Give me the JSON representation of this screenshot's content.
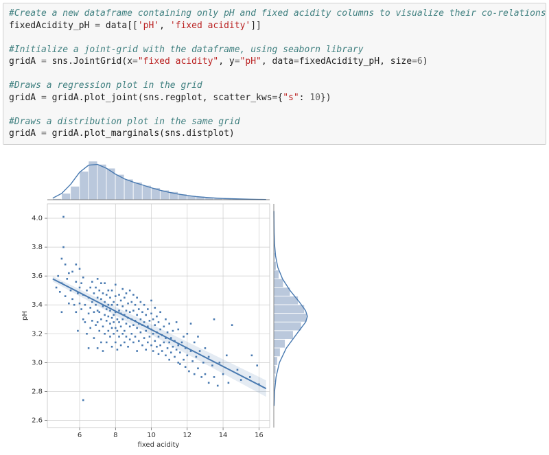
{
  "code": {
    "c1": "#Create a new dataframe containing only pH and fixed acidity columns to visualize their co-relations",
    "l1a": "fixedAcidity_pH ",
    "l1b": "=",
    "l1c": " data[[",
    "l1d": "'pH'",
    "l1e": ", ",
    "l1f": "'fixed acidity'",
    "l1g": "]]",
    "c2": "#Initialize a joint-grid with the dataframe, using seaborn library",
    "l2a": "gridA ",
    "l2b": "=",
    "l2c": " sns.JointGrid(x",
    "l2d": "=",
    "l2e": "\"fixed acidity\"",
    "l2f": ", y",
    "l2g": "=",
    "l2h": "\"pH\"",
    "l2i": ", data",
    "l2j": "=",
    "l2k": "fixedAcidity_pH, size",
    "l2l": "=",
    "l2m": "6",
    "l2n": ")",
    "c3": "#Draws a regression plot in the grid",
    "l3a": "gridA ",
    "l3b": "=",
    "l3c": " gridA.plot_joint(sns.regplot, scatter_kws",
    "l3d": "=",
    "l3e": "{",
    "l3f": "\"s\"",
    "l3g": ": ",
    "l3h": "10",
    "l3i": "})",
    "c4": "#Draws a distribution plot in the same grid",
    "l4a": "gridA ",
    "l4b": "=",
    "l4c": " gridA.plot_marginals(sns.distplot)"
  },
  "chart_data": {
    "type": "jointplot",
    "main": {
      "type": "scatter+regression",
      "xlabel": "fixed acidity",
      "ylabel": "pH",
      "x_ticks": [
        6,
        8,
        10,
        12,
        14,
        16
      ],
      "y_ticks": [
        2.6,
        2.8,
        3.0,
        3.2,
        3.4,
        3.6,
        3.8,
        4.0
      ],
      "xlim": [
        4.2,
        16.6
      ],
      "ylim": [
        2.55,
        4.1
      ],
      "regression": {
        "x0": 4.5,
        "y0": 3.58,
        "x1": 16.4,
        "y1": 2.82
      },
      "scatter_sample": [
        [
          4.7,
          3.52
        ],
        [
          4.8,
          3.6
        ],
        [
          4.9,
          3.49
        ],
        [
          5.0,
          3.72
        ],
        [
          5.0,
          3.55
        ],
        [
          5.0,
          3.35
        ],
        [
          5.1,
          4.01
        ],
        [
          5.1,
          3.8
        ],
        [
          5.2,
          3.46
        ],
        [
          5.2,
          3.68
        ],
        [
          5.3,
          3.58
        ],
        [
          5.4,
          3.62
        ],
        [
          5.4,
          3.41
        ],
        [
          5.5,
          3.5
        ],
        [
          5.6,
          3.44
        ],
        [
          5.6,
          3.63
        ],
        [
          5.7,
          3.4
        ],
        [
          5.8,
          3.56
        ],
        [
          5.8,
          3.35
        ],
        [
          5.8,
          3.68
        ],
        [
          5.9,
          3.48
        ],
        [
          5.9,
          3.22
        ],
        [
          6.0,
          3.52
        ],
        [
          6.0,
          3.41
        ],
        [
          6.0,
          3.65
        ],
        [
          6.1,
          3.37
        ],
        [
          6.1,
          3.55
        ],
        [
          6.2,
          2.74
        ],
        [
          6.2,
          3.3
        ],
        [
          6.2,
          3.47
        ],
        [
          6.2,
          3.59
        ],
        [
          6.3,
          3.4
        ],
        [
          6.3,
          3.28
        ],
        [
          6.4,
          3.5
        ],
        [
          6.4,
          3.2
        ],
        [
          6.5,
          3.45
        ],
        [
          6.5,
          3.34
        ],
        [
          6.5,
          3.1
        ],
        [
          6.6,
          3.38
        ],
        [
          6.6,
          3.52
        ],
        [
          6.6,
          3.24
        ],
        [
          6.7,
          3.29
        ],
        [
          6.7,
          3.42
        ],
        [
          6.7,
          3.56
        ],
        [
          6.8,
          3.35
        ],
        [
          6.8,
          3.17
        ],
        [
          6.8,
          3.48
        ],
        [
          6.9,
          3.26
        ],
        [
          6.9,
          3.4
        ],
        [
          6.9,
          3.52
        ],
        [
          7.0,
          3.28
        ],
        [
          7.0,
          3.1
        ],
        [
          7.0,
          3.36
        ],
        [
          7.0,
          3.45
        ],
        [
          7.0,
          3.58
        ],
        [
          7.1,
          3.22
        ],
        [
          7.1,
          3.35
        ],
        [
          7.1,
          3.5
        ],
        [
          7.2,
          3.3
        ],
        [
          7.2,
          3.14
        ],
        [
          7.2,
          3.44
        ],
        [
          7.2,
          3.55
        ],
        [
          7.3,
          3.39
        ],
        [
          7.3,
          3.25
        ],
        [
          7.3,
          3.08
        ],
        [
          7.3,
          3.48
        ],
        [
          7.4,
          3.33
        ],
        [
          7.4,
          3.2
        ],
        [
          7.4,
          3.42
        ],
        [
          7.4,
          3.55
        ],
        [
          7.5,
          3.29
        ],
        [
          7.5,
          3.37
        ],
        [
          7.5,
          3.14
        ],
        [
          7.5,
          3.47
        ],
        [
          7.6,
          3.32
        ],
        [
          7.6,
          3.22
        ],
        [
          7.6,
          3.4
        ],
        [
          7.6,
          3.5
        ],
        [
          7.7,
          3.27
        ],
        [
          7.7,
          3.36
        ],
        [
          7.7,
          3.18
        ],
        [
          7.7,
          3.45
        ],
        [
          7.8,
          3.31
        ],
        [
          7.8,
          3.24
        ],
        [
          7.8,
          3.4
        ],
        [
          7.8,
          3.11
        ],
        [
          7.8,
          3.5
        ],
        [
          7.9,
          3.33
        ],
        [
          7.9,
          3.2
        ],
        [
          7.9,
          3.42
        ],
        [
          7.9,
          3.28
        ],
        [
          8.0,
          3.35
        ],
        [
          8.0,
          3.24
        ],
        [
          8.0,
          3.14
        ],
        [
          8.0,
          3.46
        ],
        [
          8.0,
          3.54
        ],
        [
          8.1,
          3.3
        ],
        [
          8.1,
          3.22
        ],
        [
          8.1,
          3.4
        ],
        [
          8.1,
          3.09
        ],
        [
          8.2,
          3.28
        ],
        [
          8.2,
          3.36
        ],
        [
          8.2,
          3.18
        ],
        [
          8.2,
          3.47
        ],
        [
          8.3,
          3.25
        ],
        [
          8.3,
          3.34
        ],
        [
          8.3,
          3.12
        ],
        [
          8.3,
          3.43
        ],
        [
          8.4,
          3.3
        ],
        [
          8.4,
          3.2
        ],
        [
          8.4,
          3.39
        ],
        [
          8.4,
          3.51
        ],
        [
          8.5,
          3.22
        ],
        [
          8.5,
          3.33
        ],
        [
          8.5,
          3.14
        ],
        [
          8.5,
          3.45
        ],
        [
          8.6,
          3.27
        ],
        [
          8.6,
          3.18
        ],
        [
          8.6,
          3.36
        ],
        [
          8.6,
          3.48
        ],
        [
          8.7,
          3.31
        ],
        [
          8.7,
          3.11
        ],
        [
          8.7,
          3.41
        ],
        [
          8.8,
          3.25
        ],
        [
          8.8,
          3.35
        ],
        [
          8.8,
          3.16
        ],
        [
          8.8,
          3.5
        ],
        [
          8.9,
          3.2
        ],
        [
          8.9,
          3.3
        ],
        [
          8.9,
          3.42
        ],
        [
          9.0,
          3.26
        ],
        [
          9.0,
          3.14
        ],
        [
          9.0,
          3.36
        ],
        [
          9.0,
          3.47
        ],
        [
          9.1,
          3.29
        ],
        [
          9.1,
          3.18
        ],
        [
          9.1,
          3.4
        ],
        [
          9.2,
          3.24
        ],
        [
          9.2,
          3.33
        ],
        [
          9.2,
          3.08
        ],
        [
          9.2,
          3.45
        ],
        [
          9.3,
          3.27
        ],
        [
          9.3,
          3.15
        ],
        [
          9.3,
          3.37
        ],
        [
          9.4,
          3.21
        ],
        [
          9.4,
          3.3
        ],
        [
          9.4,
          3.42
        ],
        [
          9.5,
          3.26
        ],
        [
          9.5,
          3.12
        ],
        [
          9.5,
          3.35
        ],
        [
          9.6,
          3.17
        ],
        [
          9.6,
          3.28
        ],
        [
          9.6,
          3.4
        ],
        [
          9.7,
          3.22
        ],
        [
          9.7,
          3.09
        ],
        [
          9.7,
          3.33
        ],
        [
          9.8,
          3.25
        ],
        [
          9.8,
          3.14
        ],
        [
          9.8,
          3.37
        ],
        [
          9.9,
          3.18
        ],
        [
          9.9,
          3.29
        ],
        [
          10.0,
          3.12
        ],
        [
          10.0,
          3.23
        ],
        [
          10.0,
          3.34
        ],
        [
          10.0,
          3.43
        ],
        [
          10.1,
          3.2
        ],
        [
          10.1,
          3.08
        ],
        [
          10.1,
          3.3
        ],
        [
          10.2,
          3.15
        ],
        [
          10.2,
          3.26
        ],
        [
          10.2,
          3.38
        ],
        [
          10.3,
          3.11
        ],
        [
          10.3,
          3.21
        ],
        [
          10.3,
          3.32
        ],
        [
          10.4,
          3.06
        ],
        [
          10.4,
          3.18
        ],
        [
          10.4,
          3.28
        ],
        [
          10.5,
          3.12
        ],
        [
          10.5,
          3.23
        ],
        [
          10.5,
          3.35
        ],
        [
          10.6,
          3.08
        ],
        [
          10.6,
          3.19
        ],
        [
          10.7,
          3.14
        ],
        [
          10.7,
          3.25
        ],
        [
          10.8,
          3.05
        ],
        [
          10.8,
          3.17
        ],
        [
          10.8,
          3.3
        ],
        [
          10.9,
          3.1
        ],
        [
          10.9,
          3.21
        ],
        [
          11.0,
          3.02
        ],
        [
          11.0,
          3.14
        ],
        [
          11.0,
          3.27
        ],
        [
          11.1,
          3.07
        ],
        [
          11.1,
          3.17
        ],
        [
          11.2,
          3.11
        ],
        [
          11.2,
          3.22
        ],
        [
          11.3,
          3.04
        ],
        [
          11.3,
          3.15
        ],
        [
          11.4,
          3.28
        ],
        [
          11.4,
          3.09
        ],
        [
          11.5,
          3.0
        ],
        [
          11.5,
          3.12
        ],
        [
          11.5,
          3.23
        ],
        [
          11.6,
          2.99
        ],
        [
          11.6,
          3.07
        ],
        [
          11.7,
          3.14
        ],
        [
          11.8,
          3.02
        ],
        [
          11.8,
          3.18
        ],
        [
          11.9,
          2.97
        ],
        [
          11.9,
          3.1
        ],
        [
          12.0,
          3.05
        ],
        [
          12.0,
          3.2
        ],
        [
          12.1,
          2.94
        ],
        [
          12.2,
          3.08
        ],
        [
          12.2,
          3.27
        ],
        [
          12.3,
          3.01
        ],
        [
          12.4,
          2.92
        ],
        [
          12.4,
          3.14
        ],
        [
          12.5,
          3.04
        ],
        [
          12.6,
          2.96
        ],
        [
          12.6,
          3.18
        ],
        [
          12.7,
          3.08
        ],
        [
          12.8,
          2.9
        ],
        [
          12.9,
          3.0
        ],
        [
          13.0,
          3.1
        ],
        [
          13.0,
          2.92
        ],
        [
          13.2,
          2.86
        ],
        [
          13.2,
          3.04
        ],
        [
          13.4,
          2.98
        ],
        [
          13.5,
          2.9
        ],
        [
          13.5,
          3.3
        ],
        [
          13.7,
          2.84
        ],
        [
          13.8,
          3.0
        ],
        [
          14.0,
          2.92
        ],
        [
          14.2,
          3.05
        ],
        [
          14.3,
          2.86
        ],
        [
          14.5,
          3.26
        ],
        [
          14.8,
          2.95
        ],
        [
          15.0,
          2.88
        ],
        [
          15.5,
          2.9
        ],
        [
          15.6,
          3.05
        ],
        [
          15.9,
          2.98
        ],
        [
          16.0,
          2.85
        ]
      ]
    },
    "top_marginal": {
      "type": "hist+kde",
      "bins": [
        [
          4.5,
          0.006
        ],
        [
          5.0,
          0.04
        ],
        [
          5.5,
          0.085
        ],
        [
          6.0,
          0.18
        ],
        [
          6.5,
          0.245
        ],
        [
          7.0,
          0.225
        ],
        [
          7.5,
          0.2
        ],
        [
          8.0,
          0.16
        ],
        [
          8.5,
          0.13
        ],
        [
          9.0,
          0.11
        ],
        [
          9.5,
          0.09
        ],
        [
          10.0,
          0.075
        ],
        [
          10.5,
          0.06
        ],
        [
          11.0,
          0.05
        ],
        [
          11.5,
          0.035
        ],
        [
          12.0,
          0.025
        ],
        [
          12.5,
          0.02
        ],
        [
          13.0,
          0.015
        ],
        [
          13.5,
          0.01
        ],
        [
          14.0,
          0.007
        ],
        [
          14.5,
          0.005
        ],
        [
          15.0,
          0.003
        ],
        [
          15.5,
          0.002
        ]
      ],
      "kde": [
        [
          4.5,
          0.01
        ],
        [
          5.0,
          0.04
        ],
        [
          5.5,
          0.098
        ],
        [
          6.0,
          0.175
        ],
        [
          6.5,
          0.22
        ],
        [
          7.0,
          0.225
        ],
        [
          7.5,
          0.2
        ],
        [
          8.0,
          0.163
        ],
        [
          8.5,
          0.133
        ],
        [
          9.0,
          0.112
        ],
        [
          9.5,
          0.094
        ],
        [
          10.0,
          0.076
        ],
        [
          10.5,
          0.06
        ],
        [
          11.0,
          0.047
        ],
        [
          11.5,
          0.036
        ],
        [
          12.0,
          0.027
        ],
        [
          12.5,
          0.02
        ],
        [
          13.0,
          0.015
        ],
        [
          13.5,
          0.011
        ],
        [
          14.0,
          0.008
        ],
        [
          14.5,
          0.006
        ],
        [
          15.0,
          0.0045
        ],
        [
          15.5,
          0.003
        ],
        [
          16.0,
          0.002
        ],
        [
          16.4,
          0.0015
        ]
      ]
    },
    "right_marginal": {
      "type": "hist+kde",
      "bins": [
        [
          2.8,
          0.05
        ],
        [
          2.86,
          0.08
        ],
        [
          2.92,
          0.15
        ],
        [
          2.98,
          0.28
        ],
        [
          3.04,
          0.5
        ],
        [
          3.1,
          0.9
        ],
        [
          3.16,
          1.55
        ],
        [
          3.22,
          2.2
        ],
        [
          3.28,
          2.65
        ],
        [
          3.34,
          2.45
        ],
        [
          3.4,
          1.95
        ],
        [
          3.46,
          1.3
        ],
        [
          3.52,
          0.75
        ],
        [
          3.58,
          0.4
        ],
        [
          3.64,
          0.18
        ],
        [
          3.7,
          0.08
        ],
        [
          3.76,
          0.04
        ],
        [
          3.82,
          0.02
        ]
      ],
      "kde": [
        [
          2.7,
          0.02
        ],
        [
          2.8,
          0.06
        ],
        [
          2.9,
          0.18
        ],
        [
          3.0,
          0.45
        ],
        [
          3.1,
          1.0
        ],
        [
          3.2,
          1.85
        ],
        [
          3.28,
          2.55
        ],
        [
          3.32,
          2.7
        ],
        [
          3.36,
          2.55
        ],
        [
          3.42,
          2.05
        ],
        [
          3.5,
          1.3
        ],
        [
          3.58,
          0.7
        ],
        [
          3.66,
          0.32
        ],
        [
          3.74,
          0.14
        ],
        [
          3.82,
          0.06
        ],
        [
          3.9,
          0.025
        ],
        [
          4.0,
          0.01
        ],
        [
          4.05,
          0.006
        ]
      ]
    }
  }
}
